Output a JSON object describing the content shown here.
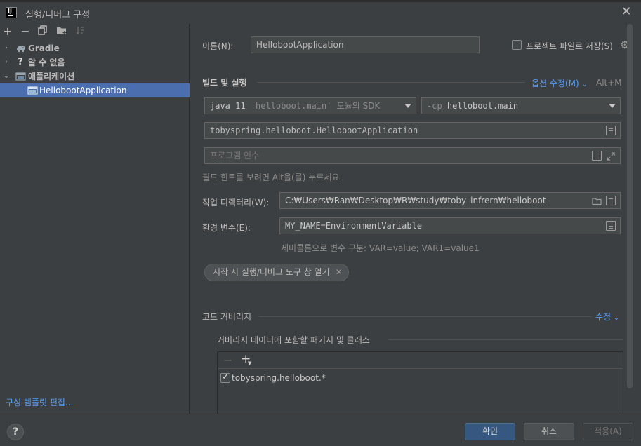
{
  "window": {
    "title": "실행/디버그 구성",
    "close_glyph": "✕"
  },
  "left_toolbar": {
    "add": "+",
    "remove": "−",
    "copy_icon": "copy-icon",
    "folder_icon": "new-folder-icon",
    "sort_icon": "sort-icon"
  },
  "tree": {
    "items": [
      {
        "label": "Gradle",
        "arrow": "›",
        "icon": "gradle-elephant-icon"
      },
      {
        "label": "알 수 없음",
        "arrow": "›",
        "icon": "question-icon"
      },
      {
        "label": "애플리케이션",
        "arrow": "⌄",
        "icon": "application-icon"
      }
    ],
    "selected_child": {
      "label": "HellobootApplication",
      "icon": "application-config-icon"
    }
  },
  "edit_templates_link": "구성 템플릿 편집...",
  "form": {
    "name_label": "이름(N):",
    "name_value": "HellobootApplication",
    "store_as_file_label": "프로젝트 파일로 저장(S)",
    "store_as_file_checked": false,
    "build_run_heading": "빌드 및 실행",
    "modify_options_link": "옵션 수정(M)",
    "modify_options_shortcut": "Alt+M",
    "sdk_java": "java 11",
    "sdk_module": "'helloboot.main'",
    "sdk_suffix": "모듈의 SDK",
    "cp_flag": "-cp",
    "cp_value": "helloboot.main",
    "main_class": "tobyspring.helloboot.HellobootApplication",
    "program_args_placeholder": "프로그램 인수",
    "field_hint": "필드 힌트를 보려면 Alt을(를) 누르세요",
    "working_dir_label": "작업 디렉터리(W):",
    "working_dir_value": "C:₩Users₩Ran₩Desktop₩R₩study₩toby_infrern₩helloboot",
    "env_label": "환경 변수(E):",
    "env_value": "MY_NAME=EnvironmentVariable",
    "env_hint": "세미콜론으로 변수 구분: VAR=value; VAR1=value1",
    "chip_label": "시작 시 실행/디버그 도구 창 열기",
    "chip_close": "✕",
    "coverage_heading": "코드 커버리지",
    "coverage_modify_link": "수정",
    "coverage_sub_heading": "커버리지 데이터에 포함할 패키지 및 클래스",
    "coverage_remove": "−",
    "coverage_add": "+",
    "coverage_entries": [
      {
        "checked": true,
        "label": "tobyspring.helloboot.*"
      }
    ]
  },
  "buttons": {
    "help": "?",
    "ok": "확인",
    "cancel": "취소",
    "apply": "적용(A)"
  },
  "colors": {
    "accent": "#589df6",
    "selection": "#4b6eaf",
    "primary_button": "#365880"
  }
}
